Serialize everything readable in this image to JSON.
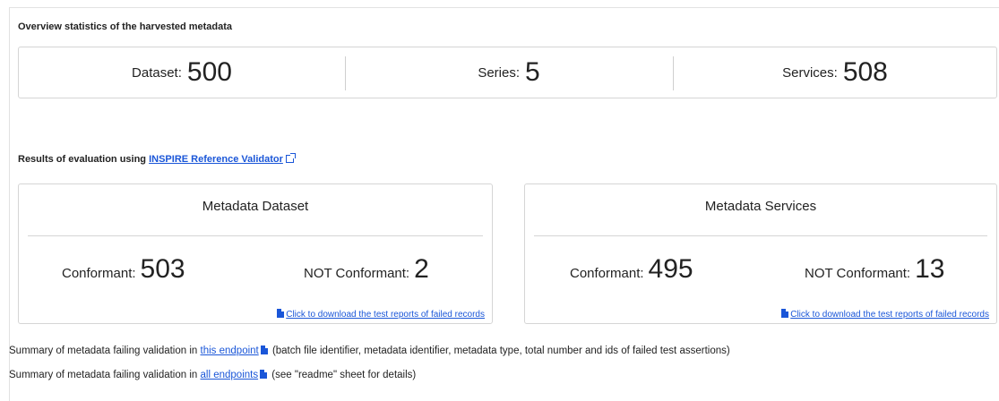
{
  "overview": {
    "title": "Overview statistics of the harvested metadata",
    "stats": [
      {
        "label": "Dataset:",
        "value": "500"
      },
      {
        "label": "Series:",
        "value": "5"
      },
      {
        "label": "Services:",
        "value": "508"
      }
    ]
  },
  "evaluation": {
    "title_prefix": "Results of evaluation using",
    "validator_link": "INSPIRE Reference Validator",
    "cards": [
      {
        "title": "Metadata Dataset",
        "conformant_label": "Conformant:",
        "conformant_value": "503",
        "not_conformant_label": "NOT Conformant:",
        "not_conformant_value": "2",
        "download_link": "Click to download the test reports of failed records"
      },
      {
        "title": "Metadata Services",
        "conformant_label": "Conformant:",
        "conformant_value": "495",
        "not_conformant_label": "NOT Conformant:",
        "not_conformant_value": "13",
        "download_link": "Click to download the test reports of failed records"
      }
    ]
  },
  "summary": {
    "line1_prefix": "Summary of metadata failing validation in",
    "line1_link": "this endpoint",
    "line1_suffix": "(batch file identifier, metadata identifier, metadata type, total number and ids of failed test assertions)",
    "line2_prefix": "Summary of metadata failing validation in",
    "line2_link": "all endpoints",
    "line2_suffix": "(see \"readme\" sheet for details)"
  }
}
